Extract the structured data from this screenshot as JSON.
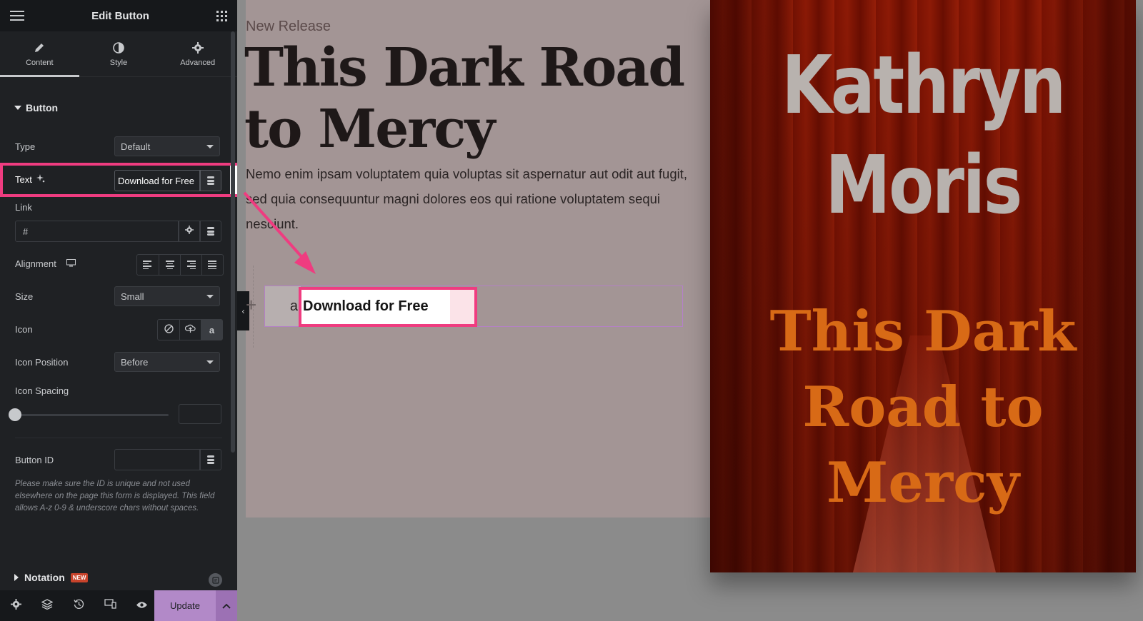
{
  "panel": {
    "title": "Edit Button",
    "tabs": [
      {
        "label": "Content",
        "icon": "pencil-icon",
        "active": true
      },
      {
        "label": "Style",
        "icon": "half-circle-icon",
        "active": false
      },
      {
        "label": "Advanced",
        "icon": "gear-icon",
        "active": false
      }
    ],
    "section": "Button",
    "type": {
      "label": "Type",
      "value": "Default"
    },
    "text": {
      "label": "Text",
      "value": "Download for Free"
    },
    "link": {
      "label": "Link",
      "value": "#"
    },
    "alignment": {
      "label": "Alignment"
    },
    "size": {
      "label": "Size",
      "value": "Small"
    },
    "icon": {
      "label": "Icon"
    },
    "icon_position": {
      "label": "Icon Position",
      "value": "Before"
    },
    "icon_spacing": {
      "label": "Icon Spacing",
      "value": 0
    },
    "button_id": {
      "label": "Button ID",
      "value": ""
    },
    "help_text": "Please make sure the ID is unique and not used elsewhere on the page this form is displayed. This field allows A-z  0-9 & underscore chars without spaces.",
    "notation": {
      "label": "Notation",
      "badge": "NEW"
    },
    "update_label": "Update"
  },
  "preview": {
    "kicker": "New Release",
    "headline": "This Dark Road to Mercy",
    "body": "Nemo enim ipsam voluptatem quia voluptas sit aspernatur aut odit aut fugit, sed quia consequuntur magni dolores eos qui ratione voluptatem sequi nesciunt.",
    "button_icon": "a",
    "button_text": "Download for Free",
    "cover_author": "Kathryn Moris",
    "cover_title": "This Dark Road to Mercy"
  },
  "colors": {
    "highlight": "#ef3c80",
    "update_button": "#b289c8",
    "panel_bg": "#1f2124"
  }
}
